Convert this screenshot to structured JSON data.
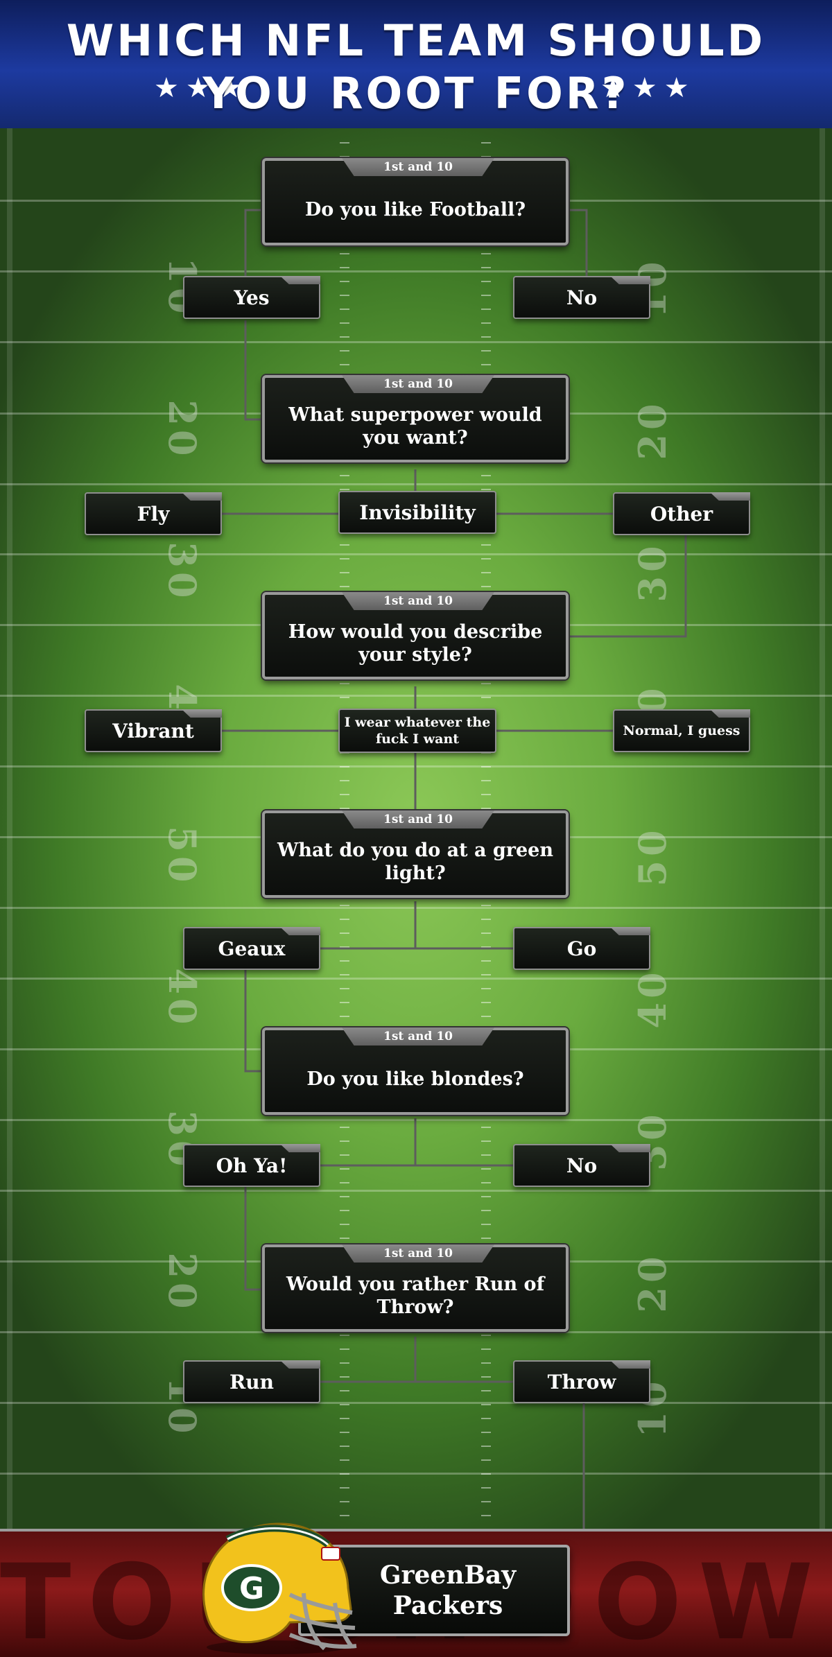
{
  "header": {
    "line1": "WHICH NFL TEAM SHOULD",
    "line2": "YOU ROOT FOR?",
    "stars_left": "★★★",
    "stars_right": "★★★"
  },
  "field": {
    "yard_numbers": [
      "10",
      "20",
      "30",
      "40",
      "50",
      "40",
      "30",
      "20",
      "10"
    ]
  },
  "questions": [
    {
      "tab": "1st and 10",
      "text": "Do you like Football?"
    },
    {
      "tab": "1st and 10",
      "text": "What superpower would you want?"
    },
    {
      "tab": "1st and 10",
      "text": "How would you describe your style?"
    },
    {
      "tab": "1st and 10",
      "text": "What do you do at a green light?"
    },
    {
      "tab": "1st and 10",
      "text": "Do you like blondes?"
    },
    {
      "tab": "1st and 10",
      "text": "Would you rather Run of Throw?"
    }
  ],
  "answers": {
    "q1": [
      "Yes",
      "No"
    ],
    "q2": [
      "Fly",
      "Invisibility",
      "Other"
    ],
    "q3": [
      "Vibrant",
      "I wear whatever the fuck I want",
      "Normal, I guess"
    ],
    "q4": [
      "Geaux",
      "Go"
    ],
    "q5": [
      "Oh Ya!",
      "No"
    ],
    "q6": [
      "Run",
      "Throw"
    ]
  },
  "endzone": {
    "word": "TOUCHDOWN",
    "result": "GreenBay Packers",
    "helmet_logo": "G",
    "helmet_icon": "green-bay-helmet-icon"
  },
  "colors": {
    "header_blue": "#1d3aa0",
    "field_green": "#6aab3f",
    "endzone_red": "#8c1a1a",
    "box_dark": "#0c0e0c",
    "border_grey": "#9a9a9a",
    "packers_green": "#1e4d2b",
    "packers_gold": "#f2c21c"
  }
}
